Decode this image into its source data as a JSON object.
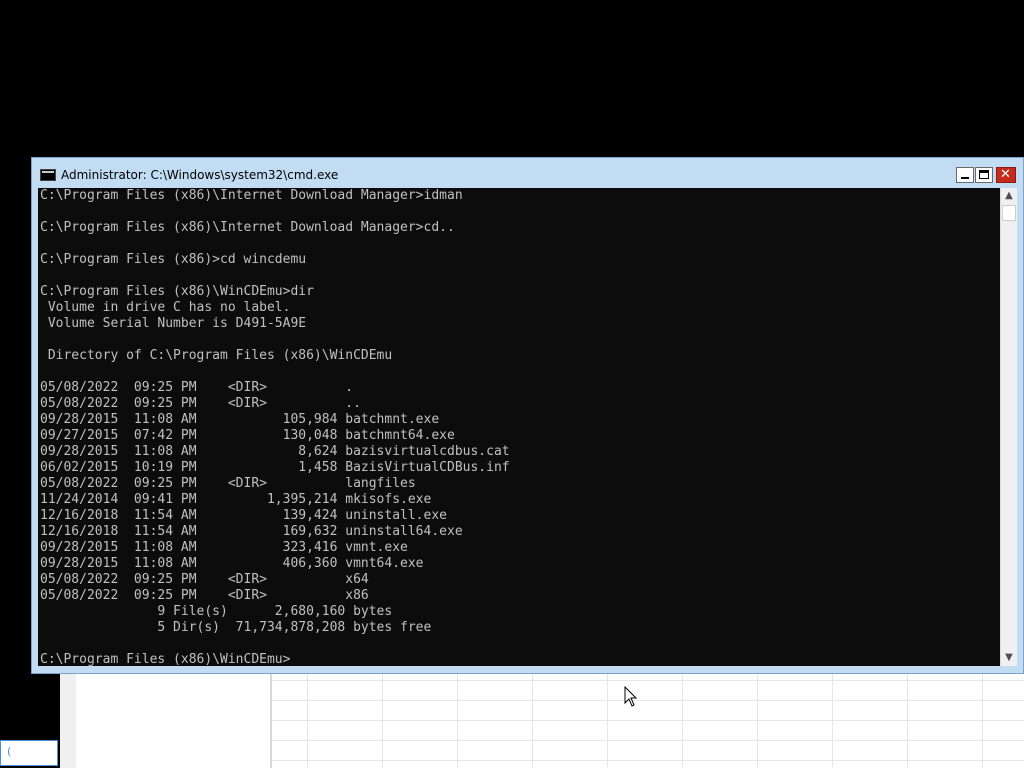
{
  "window": {
    "title": "Administrator: C:\\Windows\\system32\\cmd.exe",
    "close_glyph": "✕"
  },
  "console": {
    "lines": [
      "C:\\Program Files (x86)\\Internet Download Manager>idman",
      "",
      "C:\\Program Files (x86)\\Internet Download Manager>cd..",
      "",
      "C:\\Program Files (x86)>cd wincdemu",
      "",
      "C:\\Program Files (x86)\\WinCDEmu>dir",
      " Volume in drive C has no label.",
      " Volume Serial Number is D491-5A9E",
      "",
      " Directory of C:\\Program Files (x86)\\WinCDEmu",
      "",
      "05/08/2022  09:25 PM    <DIR>          .",
      "05/08/2022  09:25 PM    <DIR>          ..",
      "09/28/2015  11:08 AM           105,984 batchmnt.exe",
      "09/27/2015  07:42 PM           130,048 batchmnt64.exe",
      "09/28/2015  11:08 AM             8,624 bazisvirtualcdbus.cat",
      "06/02/2015  10:19 PM             1,458 BazisVirtualCDBus.inf",
      "05/08/2022  09:25 PM    <DIR>          langfiles",
      "11/24/2014  09:41 PM         1,395,214 mkisofs.exe",
      "12/16/2018  11:54 AM           139,424 uninstall.exe",
      "12/16/2018  11:54 AM           169,632 uninstall64.exe",
      "09/28/2015  11:08 AM           323,416 vmnt.exe",
      "09/28/2015  11:08 AM           406,360 vmnt64.exe",
      "05/08/2022  09:25 PM    <DIR>          x64",
      "05/08/2022  09:25 PM    <DIR>          x86",
      "               9 File(s)      2,680,160 bytes",
      "               5 Dir(s)  71,734,878,208 bytes free",
      "",
      "C:\\Program Files (x86)\\WinCDEmu>"
    ]
  },
  "scrollbar": {
    "up_glyph": "▲",
    "down_glyph": "▼"
  },
  "taskbar_fragment": {
    "text": "("
  },
  "colors": {
    "console_bg": "#0c0c0c",
    "console_fg": "#c0c0c0",
    "titlebar_bg": "#c1dcf3",
    "close_button": "#c42b1c"
  }
}
